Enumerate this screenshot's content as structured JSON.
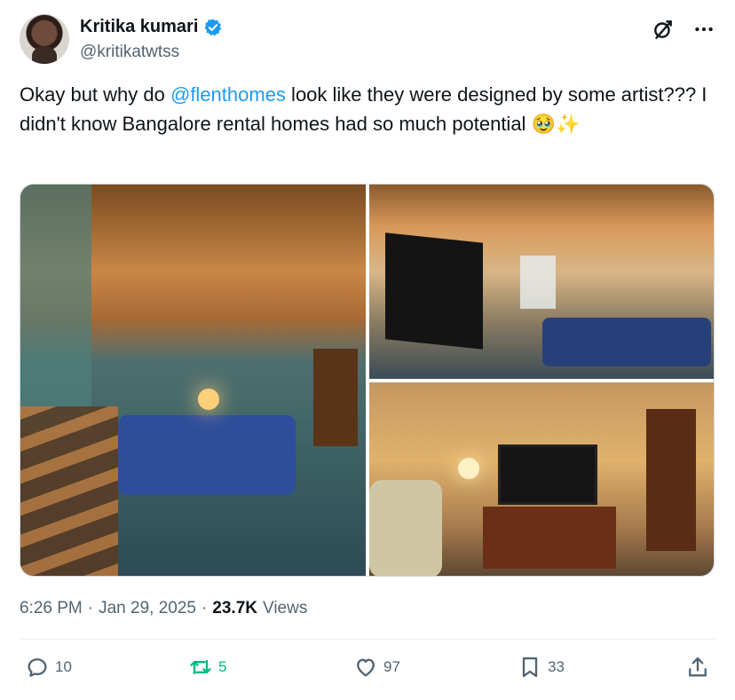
{
  "user": {
    "display_name": "Kritika kumari",
    "handle": "@kritikatwtss",
    "verified": true
  },
  "tweet": {
    "text_before": "Okay but why do ",
    "mention": "@flenthomes",
    "text_after": " look like they were designed by some artist??? I didn't know Bangalore rental homes had so much potential 🥹✨"
  },
  "meta": {
    "time": "6:26 PM",
    "sep1": "·",
    "date": "Jan 29, 2025",
    "sep2": "·",
    "views_count": "23.7K",
    "views_label": "Views"
  },
  "actions": {
    "replies": "10",
    "reposts": "5",
    "likes": "97",
    "bookmarks": "33"
  },
  "colors": {
    "accent": "#1d9bf0",
    "repost": "#00ba7c",
    "muted": "#536471"
  },
  "icons": [
    "verified-badge-icon",
    "grok-icon",
    "more-icon",
    "reply-icon",
    "retweet-icon",
    "like-icon",
    "bookmark-icon",
    "share-icon"
  ]
}
